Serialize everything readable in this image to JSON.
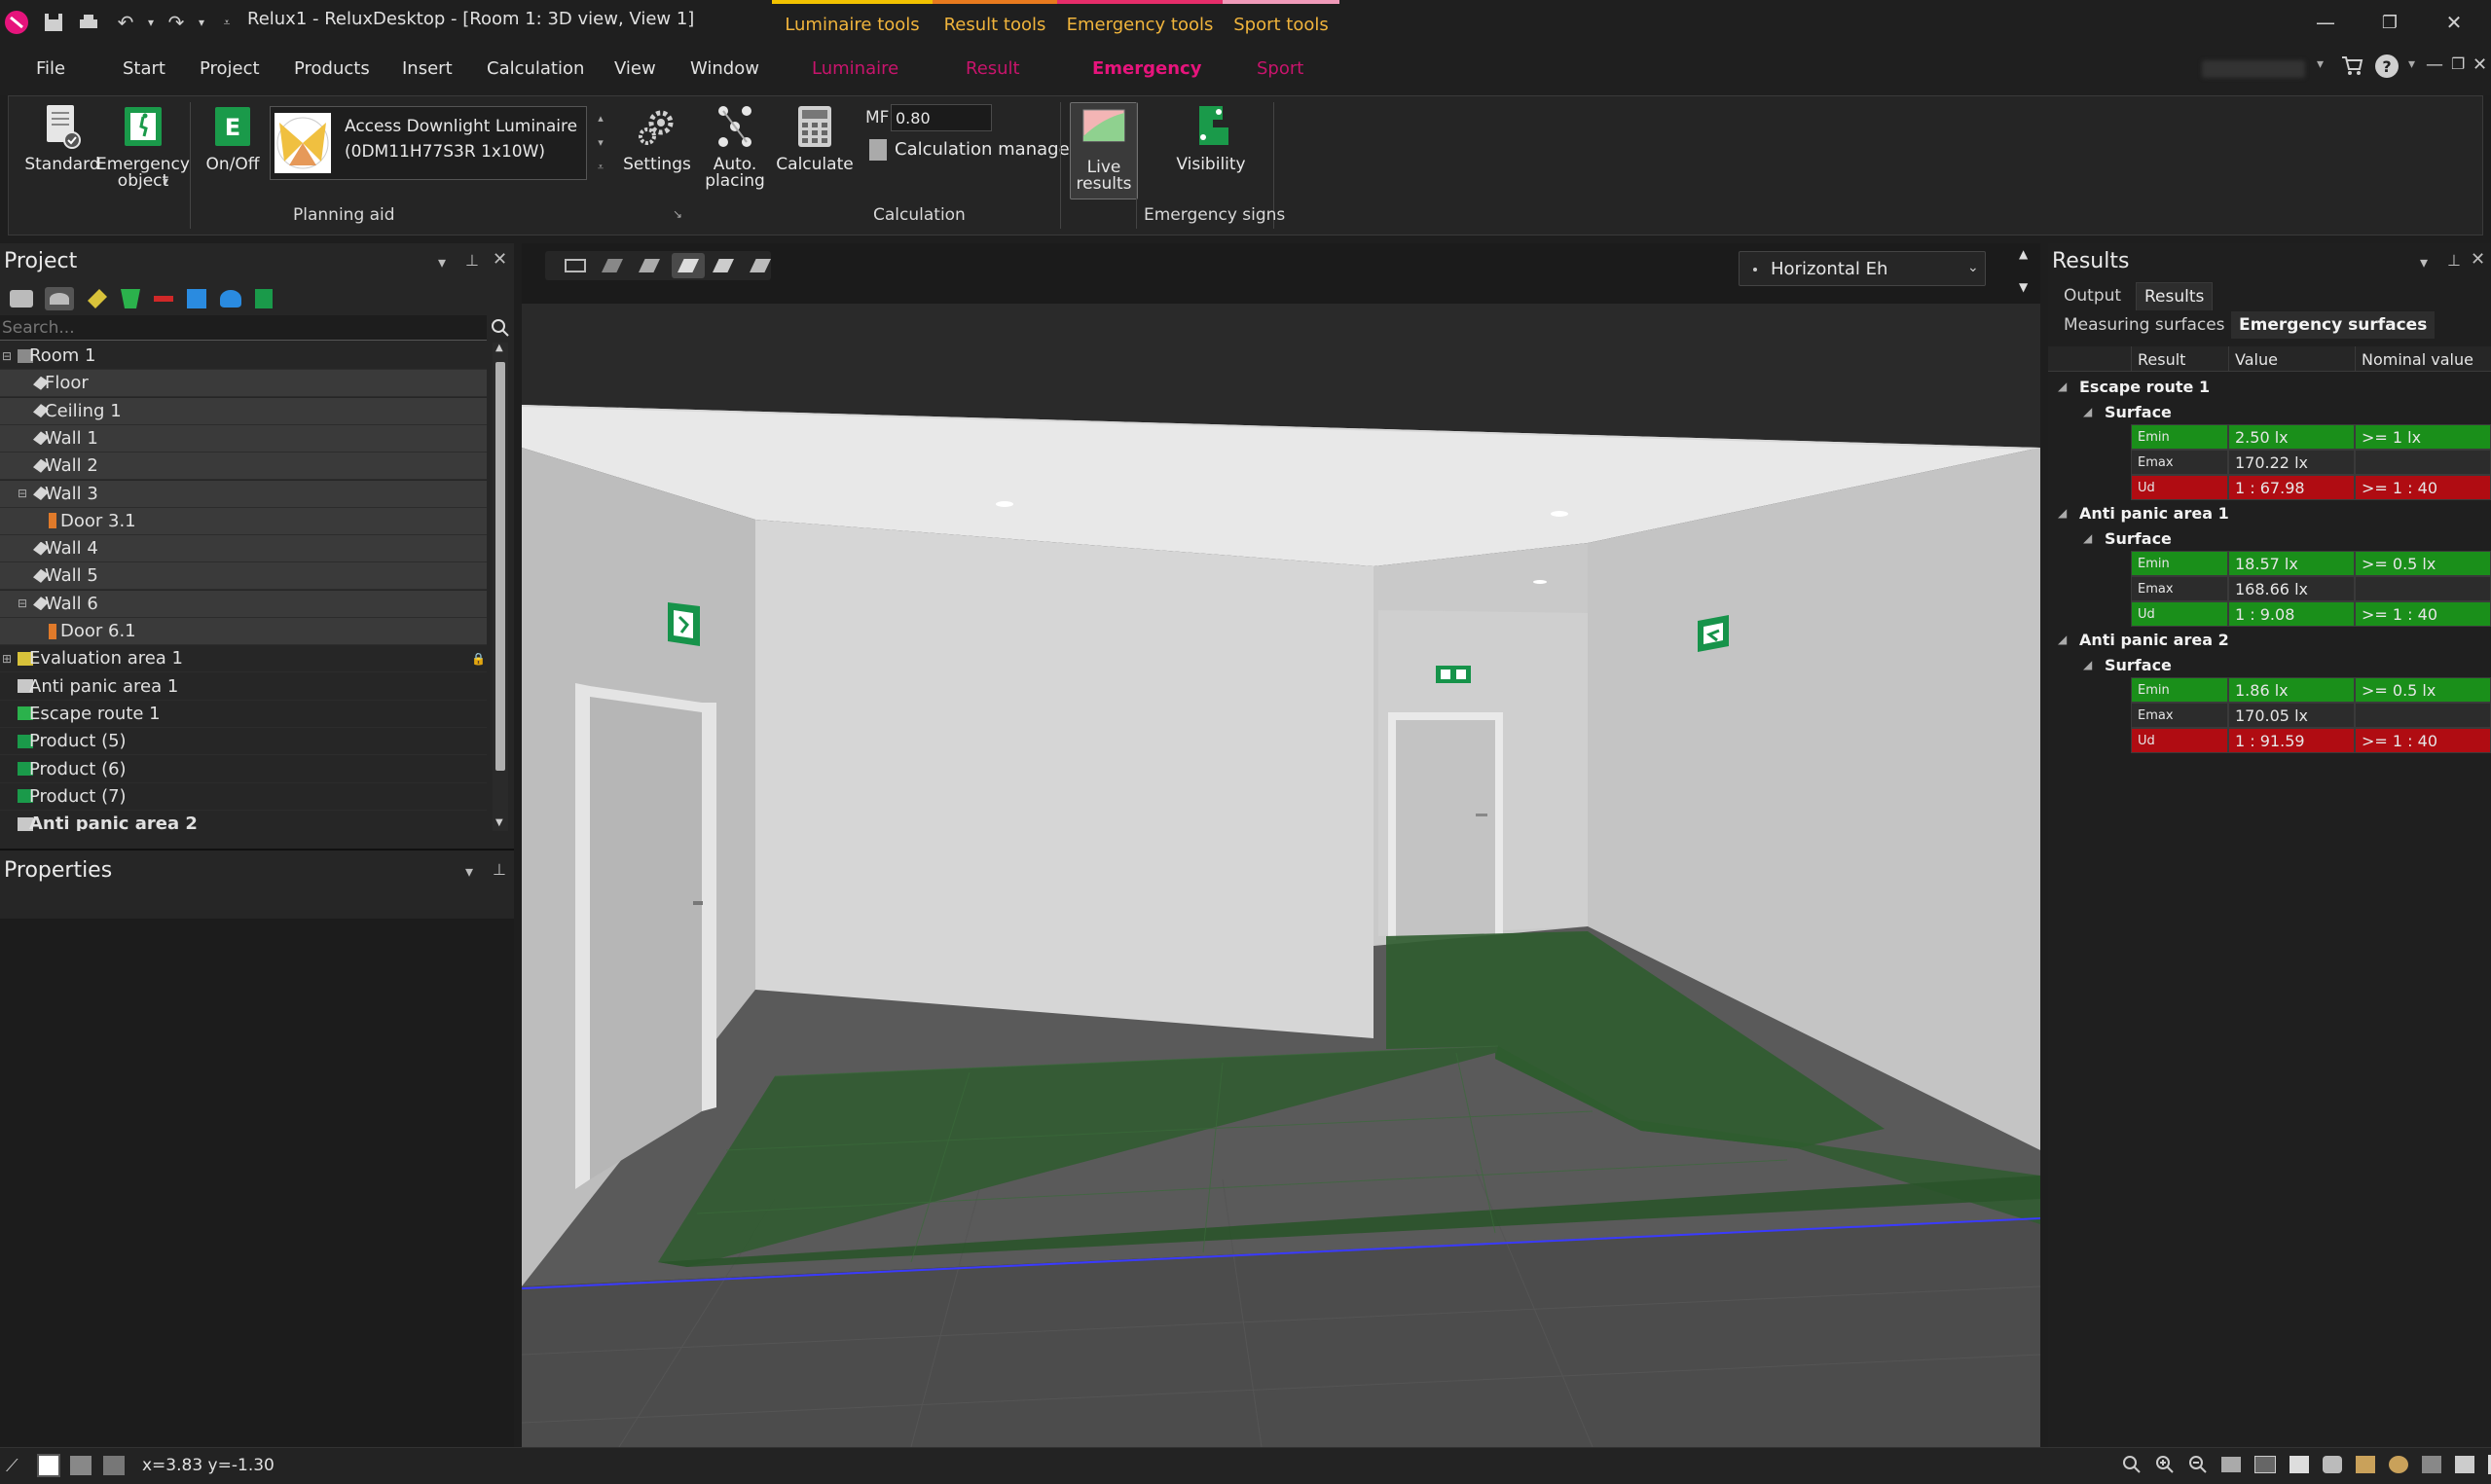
{
  "window": {
    "title": "Relux1 - ReluxDesktop - [Room 1: 3D view, View 1]",
    "context_groups": [
      {
        "label": "Luminaire tools",
        "color": "#e6a33a"
      },
      {
        "label": "Result tools",
        "color": "#e6a33a"
      },
      {
        "label": "Emergency tools",
        "color": "#e6a33a"
      },
      {
        "label": "Sport tools",
        "color": "#e6a33a"
      }
    ]
  },
  "menu": {
    "items": [
      "File",
      "Start",
      "Project",
      "Products",
      "Insert",
      "Calculation",
      "View",
      "Window"
    ],
    "context_items": [
      "Luminaire",
      "Result",
      "Emergency",
      "Sport"
    ],
    "active": "Emergency"
  },
  "ribbon": {
    "standard": "Standard",
    "emergency_object": "Emergency object",
    "on_off": "On/Off",
    "luminaire_name": "Access Downlight Luminaire",
    "luminaire_code": "(0DM11H77S3R 1x10W)",
    "settings": "Settings",
    "auto_placing": "Auto. placing",
    "calculate": "Calculate",
    "mf_label": "MF",
    "mf_value": "0.80",
    "calculation_manager": "Calculation manager",
    "live_results": "Live results",
    "visibility": "Visibility",
    "group_planning_aid": "Planning aid",
    "group_calculation": "Calculation",
    "group_emergency_signs": "Emergency signs"
  },
  "project": {
    "title": "Project",
    "search_placeholder": "Search...",
    "tree": [
      {
        "label": "Room 1",
        "level": 0,
        "toggle": "⊟",
        "icon": "room"
      },
      {
        "label": "Floor",
        "level": 1,
        "icon": "surface"
      },
      {
        "label": "Ceiling 1",
        "level": 1,
        "icon": "surface"
      },
      {
        "label": "Wall 1",
        "level": 1,
        "icon": "surface"
      },
      {
        "label": "Wall 2",
        "level": 1,
        "icon": "surface"
      },
      {
        "label": "Wall 3",
        "level": 1,
        "toggle": "⊟",
        "icon": "surface"
      },
      {
        "label": "Door 3.1",
        "level": 2,
        "icon": "door"
      },
      {
        "label": "Wall 4",
        "level": 1,
        "icon": "surface"
      },
      {
        "label": "Wall 5",
        "level": 1,
        "icon": "surface"
      },
      {
        "label": "Wall 6",
        "level": 1,
        "toggle": "⊟",
        "icon": "surface"
      },
      {
        "label": "Door 6.1",
        "level": 2,
        "icon": "door"
      },
      {
        "label": "Evaluation area 1",
        "level": 0,
        "toggle": "⊞",
        "icon": "eval"
      },
      {
        "label": "Anti panic area 1",
        "level": 0,
        "icon": "panic"
      },
      {
        "label": "Escape route 1",
        "level": 0,
        "icon": "escape"
      },
      {
        "label": "Product (5)",
        "level": 0,
        "icon": "product"
      },
      {
        "label": "Product (6)",
        "level": 0,
        "icon": "product"
      },
      {
        "label": "Product (7)",
        "level": 0,
        "icon": "product"
      },
      {
        "label": "Anti panic area 2",
        "level": 0,
        "icon": "panic",
        "bold": true
      }
    ]
  },
  "properties": {
    "title": "Properties"
  },
  "viewport": {
    "view_mode": "Horizontal Eh"
  },
  "results": {
    "title": "Results",
    "tabs": [
      "Output",
      "Results"
    ],
    "subtabs": [
      "Measuring surfaces",
      "Emergency surfaces"
    ],
    "columns": [
      "Result",
      "Value",
      "Nominal value"
    ],
    "groups": [
      {
        "name": "Escape route 1",
        "surface": "Surface",
        "rows": [
          {
            "label": "Emin",
            "value": "2.50 lx",
            "nominal": ">= 1 lx",
            "status": "ok"
          },
          {
            "label": "Emax",
            "value": "170.22 lx",
            "nominal": "",
            "status": "none"
          },
          {
            "label": "Ud",
            "value": "1 : 67.98",
            "nominal": ">= 1 : 40",
            "status": "fail"
          }
        ]
      },
      {
        "name": "Anti panic area 1",
        "surface": "Surface",
        "rows": [
          {
            "label": "Emin",
            "value": "18.57 lx",
            "nominal": ">= 0.5 lx",
            "status": "ok"
          },
          {
            "label": "Emax",
            "value": "168.66 lx",
            "nominal": "",
            "status": "none"
          },
          {
            "label": "Ud",
            "value": "1 : 9.08",
            "nominal": ">= 1 : 40",
            "status": "ok"
          }
        ]
      },
      {
        "name": "Anti panic area 2",
        "surface": "Surface",
        "rows": [
          {
            "label": "Emin",
            "value": "1.86 lx",
            "nominal": ">= 0.5 lx",
            "status": "ok"
          },
          {
            "label": "Emax",
            "value": "170.05 lx",
            "nominal": "",
            "status": "none"
          },
          {
            "label": "Ud",
            "value": "1 : 91.59",
            "nominal": ">= 1 : 40",
            "status": "fail"
          }
        ]
      }
    ]
  },
  "status": {
    "coords": "x=3.83 y=-1.30"
  },
  "colors": {
    "ok": "#1a8f1a",
    "fail": "#b00c12",
    "accent": "#e6147c",
    "escape_route": "#2d5a2d"
  }
}
